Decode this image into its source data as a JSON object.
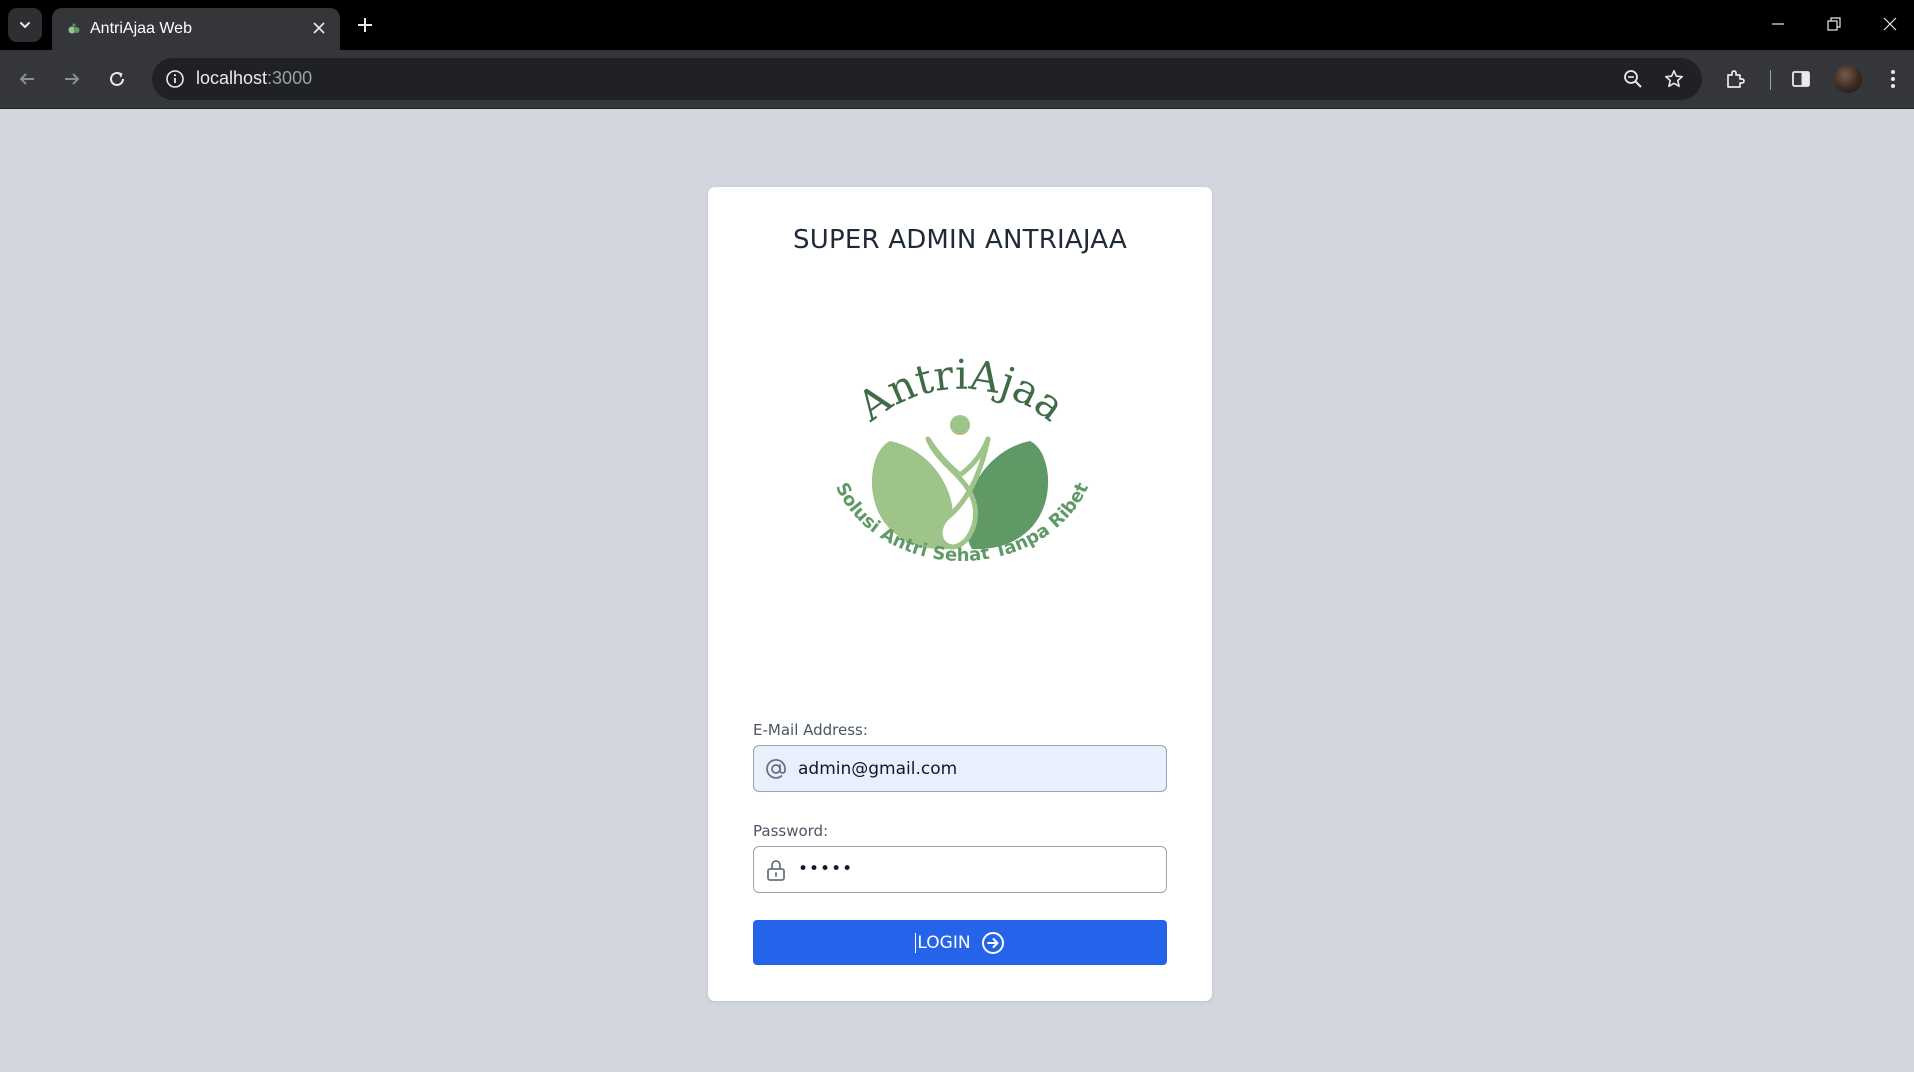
{
  "browser": {
    "tab": {
      "title": "AntriAjaa Web"
    },
    "address_bar": {
      "host": "localhost",
      "port": ":3000"
    }
  },
  "login_card": {
    "title": "SUPER ADMIN ANTRIAJAA",
    "logo": {
      "brand_text": "AntriAjaa",
      "tagline": "Solusi Antri Sehat Tanpa Ribet",
      "colors": {
        "text_dark": "#3f6b47",
        "leaf_light": "#9ec48a",
        "leaf_dark": "#5f9a66",
        "tagline": "#5f9a66"
      }
    },
    "email": {
      "label": "E-Mail Address:",
      "value": "admin@gmail.com",
      "icon": "at-icon"
    },
    "password": {
      "label": "Password:",
      "value": "•••••",
      "icon": "lock-icon"
    },
    "login_button": {
      "label": "LOGIN",
      "icon": "arrow-right-circle-icon",
      "color": "#2563eb"
    }
  }
}
